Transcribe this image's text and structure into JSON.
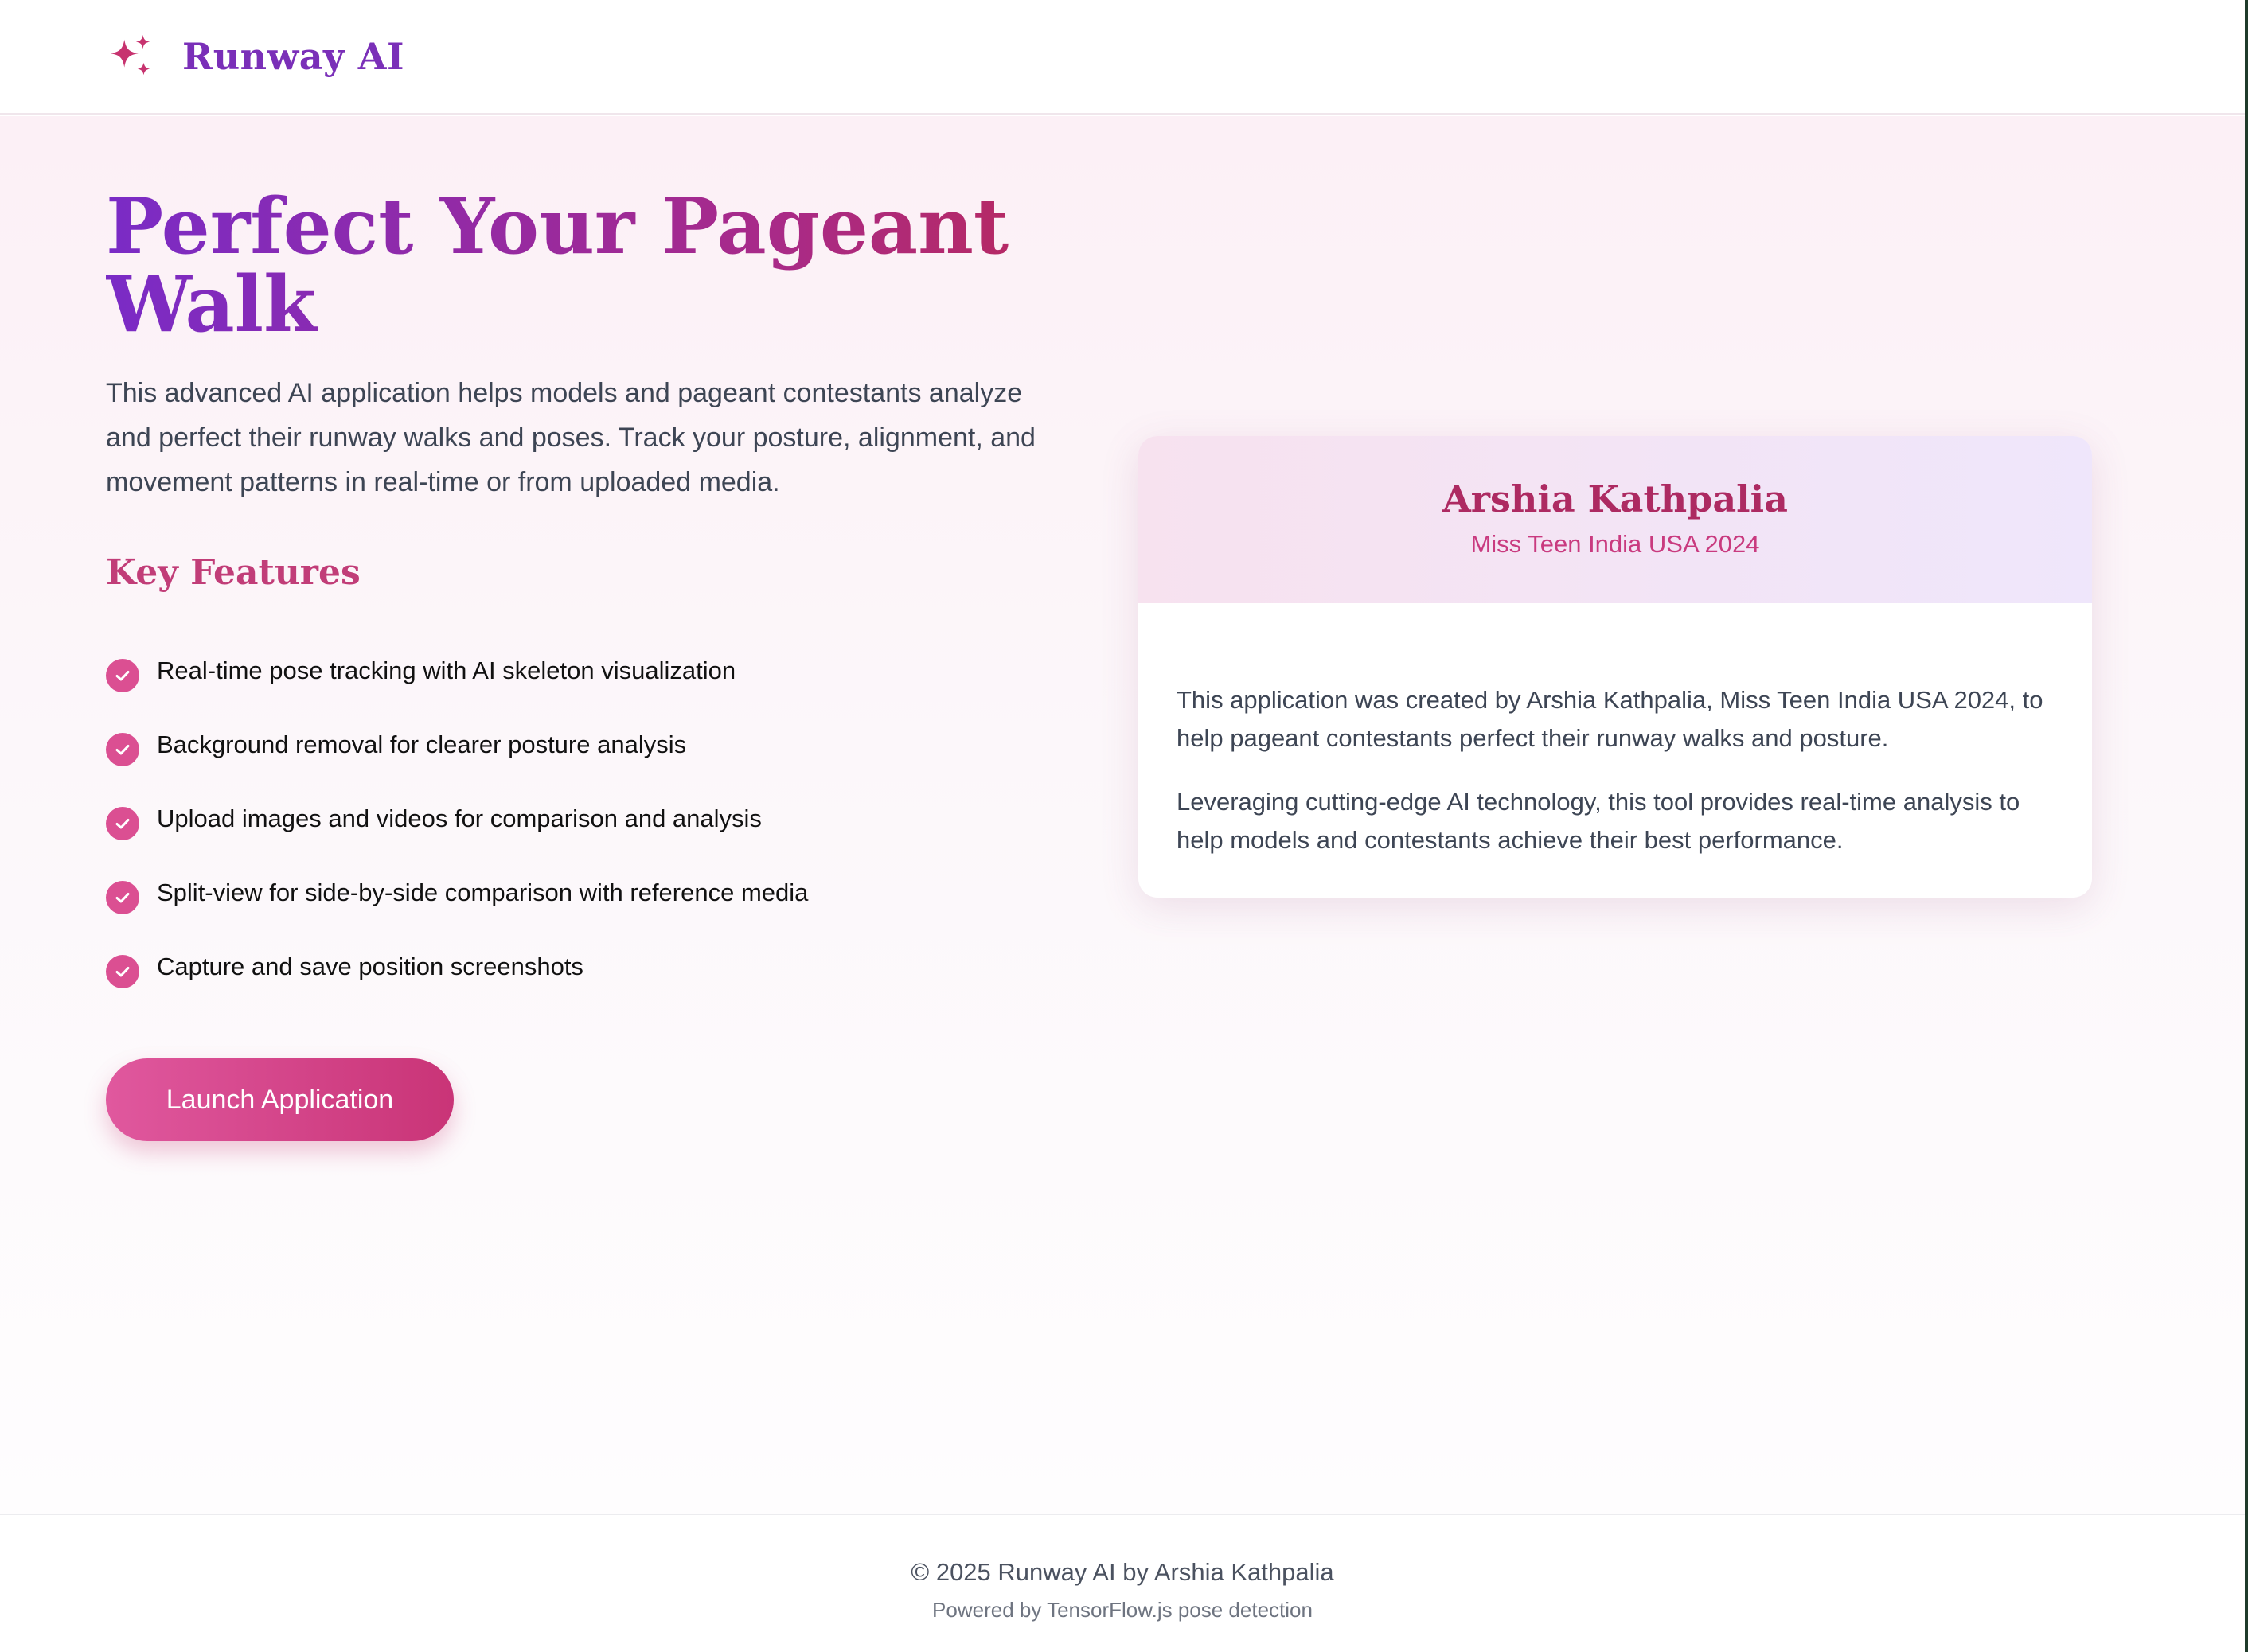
{
  "header": {
    "brand_name": "Runway AI",
    "logo_icon": "sparkles-icon"
  },
  "hero": {
    "title": "Perfect Your Pageant Walk",
    "description": "This advanced AI application helps models and pageant contestants analyze and perfect their runway walks and poses. Track your posture, alignment, and movement patterns in real-time or from uploaded media.",
    "features_heading": "Key Features",
    "features": [
      "Real-time pose tracking with AI skeleton visualization",
      "Background removal for clearer posture analysis",
      "Upload images and videos for comparison and analysis",
      "Split-view for side-by-side comparison with reference media",
      "Capture and save position screenshots"
    ],
    "feature_icon": "check-circle-icon",
    "launch_label": "Launch Application"
  },
  "creator_card": {
    "name": "Arshia Kathpalia",
    "title": "Miss Teen India USA 2024",
    "paragraphs": [
      "This application was created by Arshia Kathpalia, Miss Teen India USA 2024, to help pageant contestants perfect their runway walks and posture.",
      "Leveraging cutting-edge AI technology, this tool provides real-time analysis to help models and contestants achieve their best performance."
    ]
  },
  "footer": {
    "copyright": "© 2025 Runway AI by Arshia Kathpalia",
    "powered_by": "Powered by TensorFlow.js pose detection"
  },
  "colors": {
    "brand_purple": "#7a2fb8",
    "accent_pink": "#db4f92",
    "card_name": "#ad2a62"
  }
}
